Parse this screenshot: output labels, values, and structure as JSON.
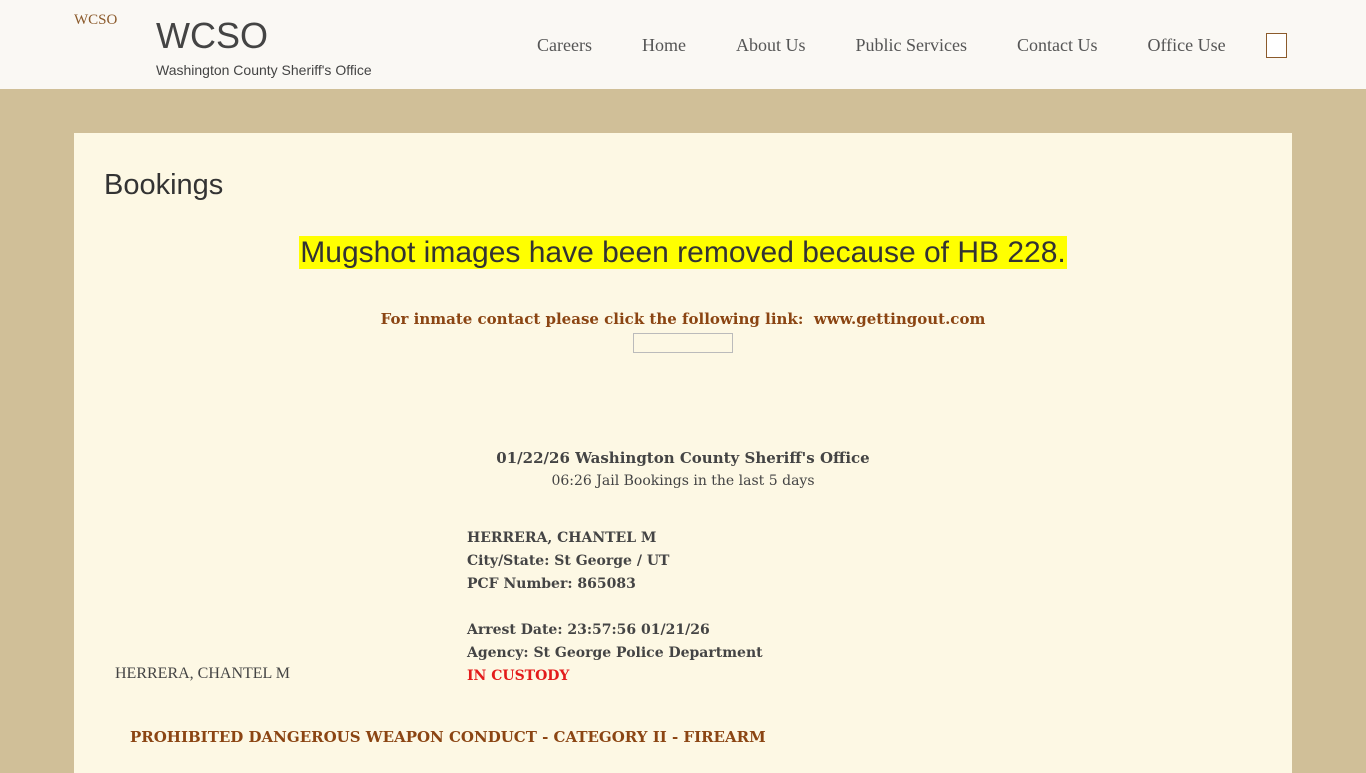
{
  "header": {
    "logo_alt": "WCSO",
    "site_title": "WCSO",
    "site_subtitle": "Washington County Sheriff's Office",
    "nav": [
      "Careers",
      "Home",
      "About Us",
      "Public Services",
      "Contact Us",
      "Office Use"
    ]
  },
  "main": {
    "page_title": "Bookings",
    "notice": "Mugshot images have been removed because of HB 228.",
    "contact_text": "For inmate contact please click the following link:",
    "contact_link": "www.gettingout.com",
    "date_line": "01/22/26 Washington County Sheriff's Office",
    "bookings_count": "06:26 Jail Bookings in the last 5 days",
    "booking": {
      "name": "HERRERA, CHANTEL M",
      "city_state": "City/State: St George / UT",
      "pcf_number": "PCF Number: 865083",
      "arrest_date": "Arrest Date: 23:57:56 01/21/26",
      "agency": "Agency: St George Police Department",
      "status": "IN CUSTODY",
      "mugshot_alt": "HERRERA, CHANTEL M",
      "charge": "PROHIBITED DANGEROUS WEAPON CONDUCT - CATEGORY II - FIREARM"
    }
  },
  "colors": {
    "page_bg": "#d0bf98",
    "header_bg": "#faf8f4",
    "content_bg": "#fdf8e4",
    "highlight": "#ffff00",
    "accent_brown": "#8b4513",
    "custody_red": "#e31b1b"
  },
  "icons": {
    "search": "search-icon"
  }
}
